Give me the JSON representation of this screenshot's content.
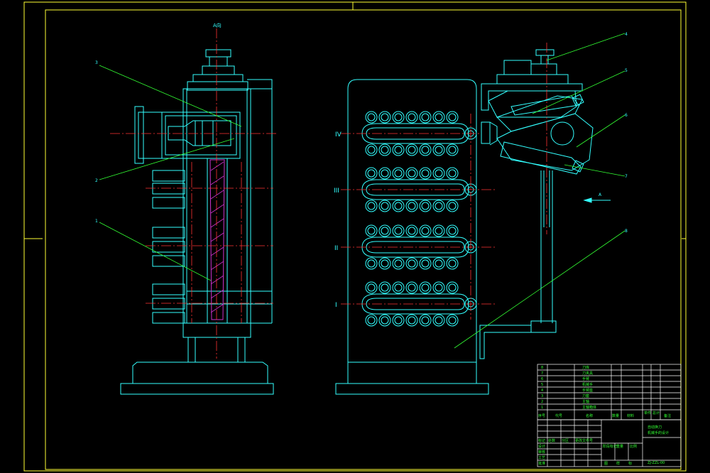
{
  "view_marks": {
    "section_top": "A向",
    "arrow": "A"
  },
  "part_labels": [
    "1",
    "2",
    "3",
    "4",
    "5",
    "6",
    "7",
    "8"
  ],
  "station_labels": [
    "IV",
    "III",
    "II",
    "I"
  ],
  "parts_list": [
    {
      "no": "8",
      "name": "刀库"
    },
    {
      "no": "7",
      "name": "刀夹具"
    },
    {
      "no": "6",
      "name": "手臂"
    },
    {
      "no": "5",
      "name": "机械手"
    },
    {
      "no": "4",
      "name": "手臂座"
    },
    {
      "no": "3",
      "name": "刀套"
    },
    {
      "no": "2",
      "name": "主轴"
    },
    {
      "no": "1",
      "name": "主轴箱体"
    }
  ],
  "parts_header": {
    "no": "序号",
    "code": "代号",
    "name": "名称",
    "qty": "数量",
    "material": "材料",
    "unit_weight": "单件",
    "total_weight": "总计",
    "remarks": "备注"
  },
  "title_block": {
    "title_line1": "自动换刀",
    "title_line2": "机械手的设计",
    "drawing_no": "ZJ-ZZL-00",
    "signatures": [
      "标记",
      "处数",
      "分区",
      "更改文件号",
      "签名",
      "年月日"
    ],
    "roles": [
      "设计",
      "审核",
      "工艺",
      "批准"
    ],
    "stage": "阶段标记",
    "weight": "重量",
    "scale": "比例",
    "sheets": "共 张 第 张",
    "stage_marks": [
      "图",
      "样",
      "标"
    ]
  },
  "colors": {
    "border": "#ffff33",
    "outline": "#33ffff",
    "leader": "#33ff33",
    "centerline": "#ff3333",
    "hatch": "#cc33cc",
    "table": "#ffffff"
  }
}
